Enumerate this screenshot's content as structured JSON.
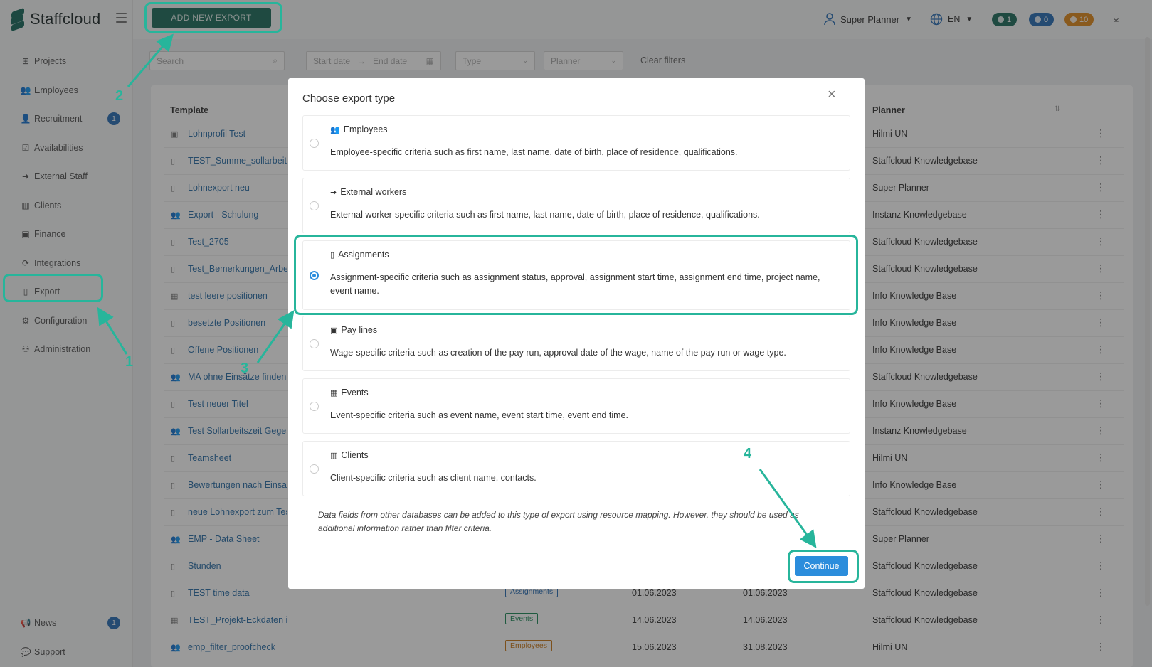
{
  "app": {
    "logo_text": "Staffcloud"
  },
  "header": {
    "add_button": "ADD NEW EXPORT",
    "user_name": "Super Planner",
    "language": "EN",
    "pills": [
      {
        "count": "1",
        "color": "#1f6d5e"
      },
      {
        "count": "0",
        "color": "#2b6fb6"
      },
      {
        "count": "10",
        "color": "#e08a1e"
      }
    ]
  },
  "sidebar": {
    "items": [
      {
        "label": "Projects",
        "icon": "sitemap-icon"
      },
      {
        "label": "Employees",
        "icon": "users-icon"
      },
      {
        "label": "Recruitment",
        "icon": "user-plus-icon",
        "badge": "1"
      },
      {
        "label": "Availabilities",
        "icon": "calendar-check-icon"
      },
      {
        "label": "External Staff",
        "icon": "sign-in-icon"
      },
      {
        "label": "Clients",
        "icon": "building-icon"
      },
      {
        "label": "Finance",
        "icon": "money-icon"
      },
      {
        "label": "Integrations",
        "icon": "sync-icon"
      },
      {
        "label": "Export",
        "icon": "file-icon"
      },
      {
        "label": "Configuration",
        "icon": "gear-icon"
      },
      {
        "label": "Administration",
        "icon": "user-cog-icon"
      }
    ],
    "bottom": [
      {
        "label": "News",
        "icon": "megaphone-icon",
        "badge": "1"
      },
      {
        "label": "Support",
        "icon": "comments-icon"
      }
    ]
  },
  "filters": {
    "search_placeholder": "Search",
    "start_date": "Start date",
    "arrow": "→",
    "end_date": "End date",
    "type": "Type",
    "planner": "Planner",
    "clear": "Clear filters"
  },
  "table": {
    "headers": {
      "template": "Template",
      "planner": "Planner"
    },
    "rows": [
      {
        "name": "Lohnprofil Test",
        "planner": "Hilmi UN",
        "icon": "money-icon"
      },
      {
        "name": "TEST_Summe_sollarbeitszeit",
        "planner": "Staffcloud Knowledgebase",
        "icon": "file-icon"
      },
      {
        "name": "Lohnexport neu",
        "planner": "Super Planner",
        "icon": "file-icon"
      },
      {
        "name": "Export - Schulung",
        "planner": "Instanz Knowledgebase",
        "icon": "users-icon"
      },
      {
        "name": "Test_2705",
        "planner": "Staffcloud Knowledgebase",
        "icon": "file-icon"
      },
      {
        "name": "Test_Bemerkungen_Arbeit",
        "planner": "Staffcloud Knowledgebase",
        "icon": "file-icon"
      },
      {
        "name": "test leere positionen",
        "planner": "Info Knowledge Base",
        "icon": "calendar-icon"
      },
      {
        "name": "besetzte Positionen",
        "planner": "Info Knowledge Base",
        "icon": "file-icon"
      },
      {
        "name": "Offene Positionen",
        "planner": "Info Knowledge Base",
        "icon": "file-icon"
      },
      {
        "name": "MA ohne Einsätze finden",
        "planner": "Staffcloud Knowledgebase",
        "icon": "users-icon"
      },
      {
        "name": "Test neuer Titel",
        "planner": "Info Knowledge Base",
        "icon": "file-icon"
      },
      {
        "name": "Test Sollarbeitszeit Gegen",
        "planner": "Instanz Knowledgebase",
        "icon": "users-icon"
      },
      {
        "name": "Teamsheet",
        "planner": "Hilmi UN",
        "icon": "file-icon"
      },
      {
        "name": "Bewertungen nach Einsatz",
        "planner": "Info Knowledge Base",
        "icon": "file-icon"
      },
      {
        "name": "neue Lohnexport zum Test",
        "planner": "Staffcloud Knowledgebase",
        "icon": "file-icon"
      },
      {
        "name": "EMP - Data Sheet",
        "planner": "Super Planner",
        "icon": "users-icon"
      },
      {
        "name": "Stunden",
        "planner": "Staffcloud Knowledgebase",
        "icon": "file-icon"
      },
      {
        "name": "TEST time data",
        "planner": "Staffcloud Knowledgebase",
        "icon": "file-icon",
        "type": "Assignments",
        "type_color": "#2b6fb6",
        "d1": "01.06.2023",
        "d2": "01.06.2023"
      },
      {
        "name": "TEST_Projekt-Eckdaten in PM",
        "planner": "Staffcloud Knowledgebase",
        "icon": "calendar-icon",
        "type": "Events",
        "type_color": "#1f8a5a",
        "d1": "14.06.2023",
        "d2": "14.06.2023"
      },
      {
        "name": "emp_filter_proofcheck",
        "planner": "Hilmi UN",
        "icon": "users-icon",
        "type": "Employees",
        "type_color": "#c9781a",
        "d1": "15.06.2023",
        "d2": "31.08.2023"
      }
    ]
  },
  "modal": {
    "title": "Choose export type",
    "options": [
      {
        "title": "Employees",
        "icon": "users-icon",
        "desc": "Employee-specific criteria such as first name, last name, date of birth, place of residence, qualifications.",
        "selected": false
      },
      {
        "title": "External workers",
        "icon": "sign-in-icon",
        "desc": "External worker-specific criteria such as first name, last name, date of birth, place of residence, qualifications.",
        "selected": false
      },
      {
        "title": "Assignments",
        "icon": "file-icon",
        "desc": "Assignment-specific criteria such as assignment status, approval, assignment start time, assignment end time, project name, event name.",
        "selected": true
      },
      {
        "title": "Pay lines",
        "icon": "money-icon",
        "desc": "Wage-specific criteria such as creation of the pay run, approval date of the wage, name of the pay run or wage type.",
        "selected": false
      },
      {
        "title": "Events",
        "icon": "calendar-icon",
        "desc": "Event-specific criteria such as event name, event start time, event end time.",
        "selected": false
      },
      {
        "title": "Clients",
        "icon": "building-icon",
        "desc": "Client-specific criteria such as client name, contacts.",
        "selected": false
      }
    ],
    "note": "Data fields from other databases can be added to this type of export using resource mapping. However, they should be used as additional information rather than filter criteria.",
    "continue": "Continue"
  },
  "annotations": {
    "n1": "1",
    "n2": "2",
    "n3": "3",
    "n4": "4",
    "color": "#27b59b"
  }
}
